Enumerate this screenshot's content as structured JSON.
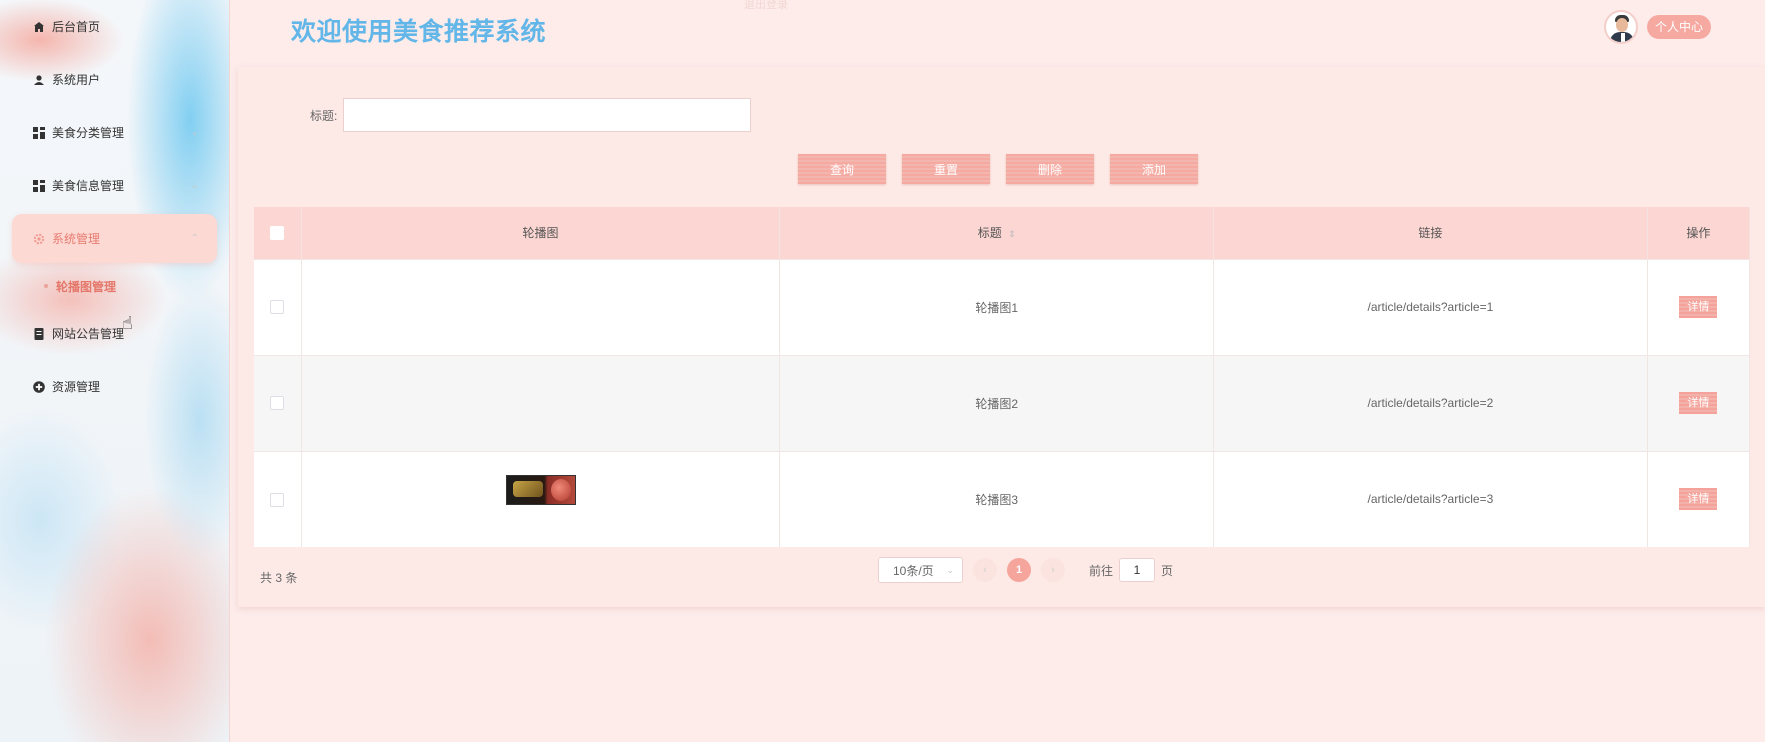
{
  "header": {
    "title": "欢迎使用美食推荐系统",
    "faint_notice": "退出登录",
    "profile_button": "个人中心"
  },
  "sidebar": {
    "items": [
      {
        "label": "后台首页",
        "icon": "home-icon"
      },
      {
        "label": "系统用户",
        "icon": "user-icon"
      },
      {
        "label": "美食分类管理",
        "icon": "grid-icon"
      },
      {
        "label": "美食信息管理",
        "icon": "grid-icon"
      },
      {
        "label": "系统管理",
        "icon": "gear-icon",
        "active": true
      },
      {
        "label": "网站公告管理",
        "icon": "document-icon"
      },
      {
        "label": "资源管理",
        "icon": "plus-circle-icon"
      }
    ],
    "submenu": {
      "label": "轮播图管理"
    }
  },
  "search": {
    "label": "标题:",
    "value": "",
    "placeholder": ""
  },
  "toolbar": {
    "query_label": "查询",
    "reset_label": "重置",
    "delete_label": "删除",
    "add_label": "添加"
  },
  "table": {
    "columns": [
      "轮播图",
      "标题",
      "链接",
      "操作"
    ],
    "rows": [
      {
        "image": "",
        "title": "轮播图1",
        "link": "/article/details?article=1",
        "action": "详情"
      },
      {
        "image": "",
        "title": "轮播图2",
        "link": "/article/details?article=2",
        "action": "详情"
      },
      {
        "image": "food-thumbnail",
        "title": "轮播图3",
        "link": "/article/details?article=3",
        "action": "详情"
      }
    ]
  },
  "pagination": {
    "total_text": "共 3 条",
    "page_size": "10条/页",
    "current_page": "1",
    "goto_label": "前往",
    "goto_value": "1",
    "page_unit": "页"
  },
  "colors": {
    "accent": "#f5a59b",
    "title": "#62b6e8",
    "background": "#fdecea"
  }
}
